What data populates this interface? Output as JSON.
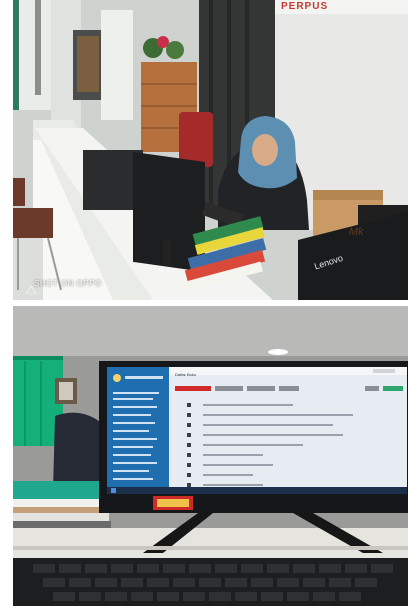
{
  "photo_top": {
    "watermark": "SHOT ON OPPO",
    "sign_text": "PERPUS",
    "monitor_brand": "Lenovo",
    "box_text": "Mk"
  },
  "photo_bottom": {
    "screen_title": "Daftar Buku"
  },
  "colors": {
    "wall": "#cfd2cf",
    "pillar": "#3b3d3c",
    "headscarf": "#5d8fb3",
    "desk": "#f0f0ee",
    "screen_sidebar": "#1f6fb0",
    "curtain": "#15b07a",
    "red_button": "#d22a2a"
  }
}
